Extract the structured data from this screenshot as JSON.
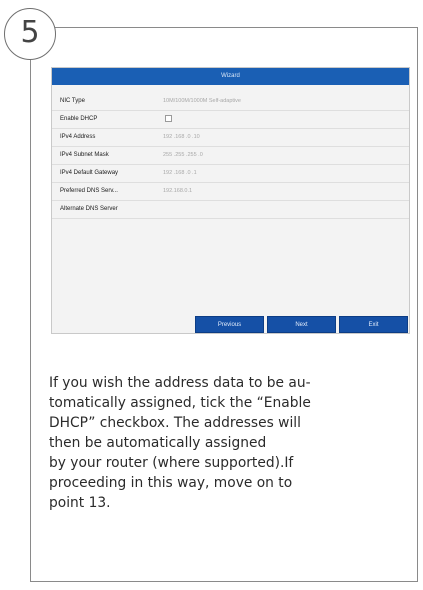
{
  "step_number": "5",
  "wizard": {
    "title": "Wizard",
    "rows": [
      {
        "label": "NIC Type",
        "value": "10M/100M/1000M Self-adaptive"
      },
      {
        "label": "Enable DHCP",
        "value": ""
      },
      {
        "label": "IPv4 Address",
        "value": "192 .168 .0 .10"
      },
      {
        "label": "IPv4 Subnet Mask",
        "value": "255 .255 .255 .0"
      },
      {
        "label": "IPv4 Default Gateway",
        "value": "192 .168 .0 .1"
      },
      {
        "label": "Preferred DNS Serv...",
        "value": "192.168.0.1"
      },
      {
        "label": "Alternate DNS Server",
        "value": ""
      }
    ],
    "dhcp_checked": false,
    "buttons": {
      "previous": "Previous",
      "next": "Next",
      "exit": "Exit"
    }
  },
  "description_lines": [
    "If you wish the address data to be au-",
    "tomatically assigned, tick the “Enable",
    "DHCP” checkbox. The addresses will",
    "then be automatically assigned",
    "by your router (where supported).If",
    "proceeding in this way, move on to",
    "point 13."
  ],
  "colors": {
    "accent": "#1a5fb4",
    "button": "#1550a6",
    "text": "#2b2b2b"
  }
}
